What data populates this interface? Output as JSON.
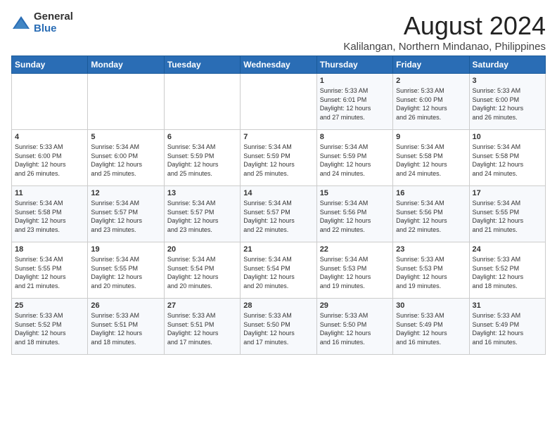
{
  "logo": {
    "general": "General",
    "blue": "Blue"
  },
  "title": "August 2024",
  "location": "Kalilangan, Northern Mindanao, Philippines",
  "weekdays": [
    "Sunday",
    "Monday",
    "Tuesday",
    "Wednesday",
    "Thursday",
    "Friday",
    "Saturday"
  ],
  "weeks": [
    [
      {
        "day": "",
        "info": ""
      },
      {
        "day": "",
        "info": ""
      },
      {
        "day": "",
        "info": ""
      },
      {
        "day": "",
        "info": ""
      },
      {
        "day": "1",
        "info": "Sunrise: 5:33 AM\nSunset: 6:01 PM\nDaylight: 12 hours\nand 27 minutes."
      },
      {
        "day": "2",
        "info": "Sunrise: 5:33 AM\nSunset: 6:00 PM\nDaylight: 12 hours\nand 26 minutes."
      },
      {
        "day": "3",
        "info": "Sunrise: 5:33 AM\nSunset: 6:00 PM\nDaylight: 12 hours\nand 26 minutes."
      }
    ],
    [
      {
        "day": "4",
        "info": "Sunrise: 5:33 AM\nSunset: 6:00 PM\nDaylight: 12 hours\nand 26 minutes."
      },
      {
        "day": "5",
        "info": "Sunrise: 5:34 AM\nSunset: 6:00 PM\nDaylight: 12 hours\nand 25 minutes."
      },
      {
        "day": "6",
        "info": "Sunrise: 5:34 AM\nSunset: 5:59 PM\nDaylight: 12 hours\nand 25 minutes."
      },
      {
        "day": "7",
        "info": "Sunrise: 5:34 AM\nSunset: 5:59 PM\nDaylight: 12 hours\nand 25 minutes."
      },
      {
        "day": "8",
        "info": "Sunrise: 5:34 AM\nSunset: 5:59 PM\nDaylight: 12 hours\nand 24 minutes."
      },
      {
        "day": "9",
        "info": "Sunrise: 5:34 AM\nSunset: 5:58 PM\nDaylight: 12 hours\nand 24 minutes."
      },
      {
        "day": "10",
        "info": "Sunrise: 5:34 AM\nSunset: 5:58 PM\nDaylight: 12 hours\nand 24 minutes."
      }
    ],
    [
      {
        "day": "11",
        "info": "Sunrise: 5:34 AM\nSunset: 5:58 PM\nDaylight: 12 hours\nand 23 minutes."
      },
      {
        "day": "12",
        "info": "Sunrise: 5:34 AM\nSunset: 5:57 PM\nDaylight: 12 hours\nand 23 minutes."
      },
      {
        "day": "13",
        "info": "Sunrise: 5:34 AM\nSunset: 5:57 PM\nDaylight: 12 hours\nand 23 minutes."
      },
      {
        "day": "14",
        "info": "Sunrise: 5:34 AM\nSunset: 5:57 PM\nDaylight: 12 hours\nand 22 minutes."
      },
      {
        "day": "15",
        "info": "Sunrise: 5:34 AM\nSunset: 5:56 PM\nDaylight: 12 hours\nand 22 minutes."
      },
      {
        "day": "16",
        "info": "Sunrise: 5:34 AM\nSunset: 5:56 PM\nDaylight: 12 hours\nand 22 minutes."
      },
      {
        "day": "17",
        "info": "Sunrise: 5:34 AM\nSunset: 5:55 PM\nDaylight: 12 hours\nand 21 minutes."
      }
    ],
    [
      {
        "day": "18",
        "info": "Sunrise: 5:34 AM\nSunset: 5:55 PM\nDaylight: 12 hours\nand 21 minutes."
      },
      {
        "day": "19",
        "info": "Sunrise: 5:34 AM\nSunset: 5:55 PM\nDaylight: 12 hours\nand 20 minutes."
      },
      {
        "day": "20",
        "info": "Sunrise: 5:34 AM\nSunset: 5:54 PM\nDaylight: 12 hours\nand 20 minutes."
      },
      {
        "day": "21",
        "info": "Sunrise: 5:34 AM\nSunset: 5:54 PM\nDaylight: 12 hours\nand 20 minutes."
      },
      {
        "day": "22",
        "info": "Sunrise: 5:34 AM\nSunset: 5:53 PM\nDaylight: 12 hours\nand 19 minutes."
      },
      {
        "day": "23",
        "info": "Sunrise: 5:33 AM\nSunset: 5:53 PM\nDaylight: 12 hours\nand 19 minutes."
      },
      {
        "day": "24",
        "info": "Sunrise: 5:33 AM\nSunset: 5:52 PM\nDaylight: 12 hours\nand 18 minutes."
      }
    ],
    [
      {
        "day": "25",
        "info": "Sunrise: 5:33 AM\nSunset: 5:52 PM\nDaylight: 12 hours\nand 18 minutes."
      },
      {
        "day": "26",
        "info": "Sunrise: 5:33 AM\nSunset: 5:51 PM\nDaylight: 12 hours\nand 18 minutes."
      },
      {
        "day": "27",
        "info": "Sunrise: 5:33 AM\nSunset: 5:51 PM\nDaylight: 12 hours\nand 17 minutes."
      },
      {
        "day": "28",
        "info": "Sunrise: 5:33 AM\nSunset: 5:50 PM\nDaylight: 12 hours\nand 17 minutes."
      },
      {
        "day": "29",
        "info": "Sunrise: 5:33 AM\nSunset: 5:50 PM\nDaylight: 12 hours\nand 16 minutes."
      },
      {
        "day": "30",
        "info": "Sunrise: 5:33 AM\nSunset: 5:49 PM\nDaylight: 12 hours\nand 16 minutes."
      },
      {
        "day": "31",
        "info": "Sunrise: 5:33 AM\nSunset: 5:49 PM\nDaylight: 12 hours\nand 16 minutes."
      }
    ]
  ]
}
